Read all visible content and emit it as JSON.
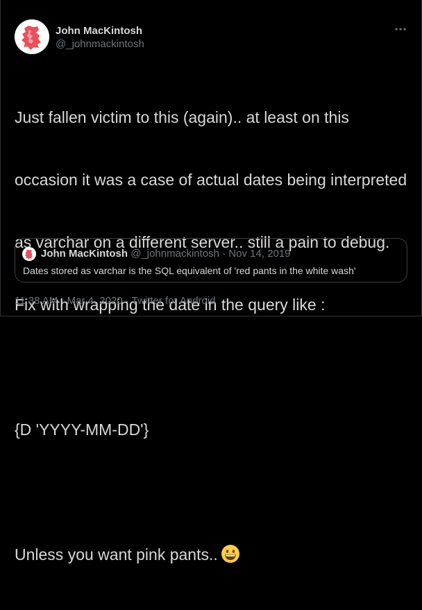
{
  "colors": {
    "background": "#000000",
    "text": "#d9d9d9",
    "secondary": "#6e767d",
    "border": "#2f3336",
    "avatar_accent": "#e8505b"
  },
  "tweet": {
    "author": {
      "display_name": "John MacKintosh",
      "handle": "@_johnmackintosh",
      "avatar_icon": "map-avatar-icon"
    },
    "more_icon": "more-horizontal-icon",
    "body_lines": {
      "line1": "Just fallen victim to this (again).. at least on this",
      "line2": "occasion it was a case of actual dates being interpreted",
      "line3": "as varchar on a different server.. still a pain to debug.",
      "line4": "Fix with wrapping the date in the query like :",
      "line5": "",
      "line6": "{D 'YYYY-MM-DD'}",
      "line7": "",
      "line8": "Unless you want pink pants.."
    },
    "emoji_icon": "grinning-face-emoji-icon",
    "quoted_tweet": {
      "display_name": "John MacKintosh",
      "handle": "@_johnmackintosh",
      "separator": "·",
      "date": "Nov 14, 2019",
      "text": "Dates stored as varchar is the SQL equivalent of 'red pants in the white wash'"
    },
    "footer": {
      "time": "11:38 AM",
      "separator1": "·",
      "date": "Mar 4, 2020",
      "separator2": "·",
      "source": "Twitter for Android"
    }
  }
}
